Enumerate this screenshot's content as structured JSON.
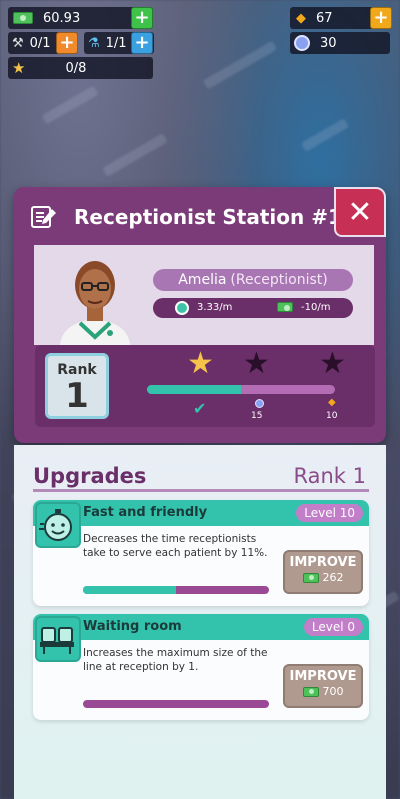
{
  "hud": {
    "cash": "60.93",
    "builders": "0/1",
    "researchers": "1/1",
    "stars": "0/8",
    "gems": "67",
    "crystals": "30"
  },
  "station": {
    "title": "Receptionist Station #1",
    "staff_name": "Amelia",
    "staff_role": "(Receptionist)",
    "service_rate": "3.33/m",
    "wage": "-10/m",
    "rank_label": "Rank",
    "rank_value": "1",
    "reward_crystals": "15",
    "reward_gems": "10",
    "progress": 0.5
  },
  "upgrades": {
    "title": "Upgrades",
    "rank_title": "Rank 1",
    "items": [
      {
        "name": "Fast and friendly",
        "level": "Level 10",
        "description": "Decreases the time receptionists take to serve each patient by 11%.",
        "improve_label": "IMPROVE",
        "cost": "262",
        "progress": 0.5
      },
      {
        "name": "Waiting room",
        "level": "Level 0",
        "description": "Increases the maximum size of the line at reception by 1.",
        "improve_label": "IMPROVE",
        "cost": "700",
        "progress": 0.0
      }
    ]
  },
  "colors": {
    "panel_purple": "#7b3a78",
    "close_red": "#c72f55",
    "teal": "#33c3ac",
    "star_gold": "#f6c34a"
  }
}
